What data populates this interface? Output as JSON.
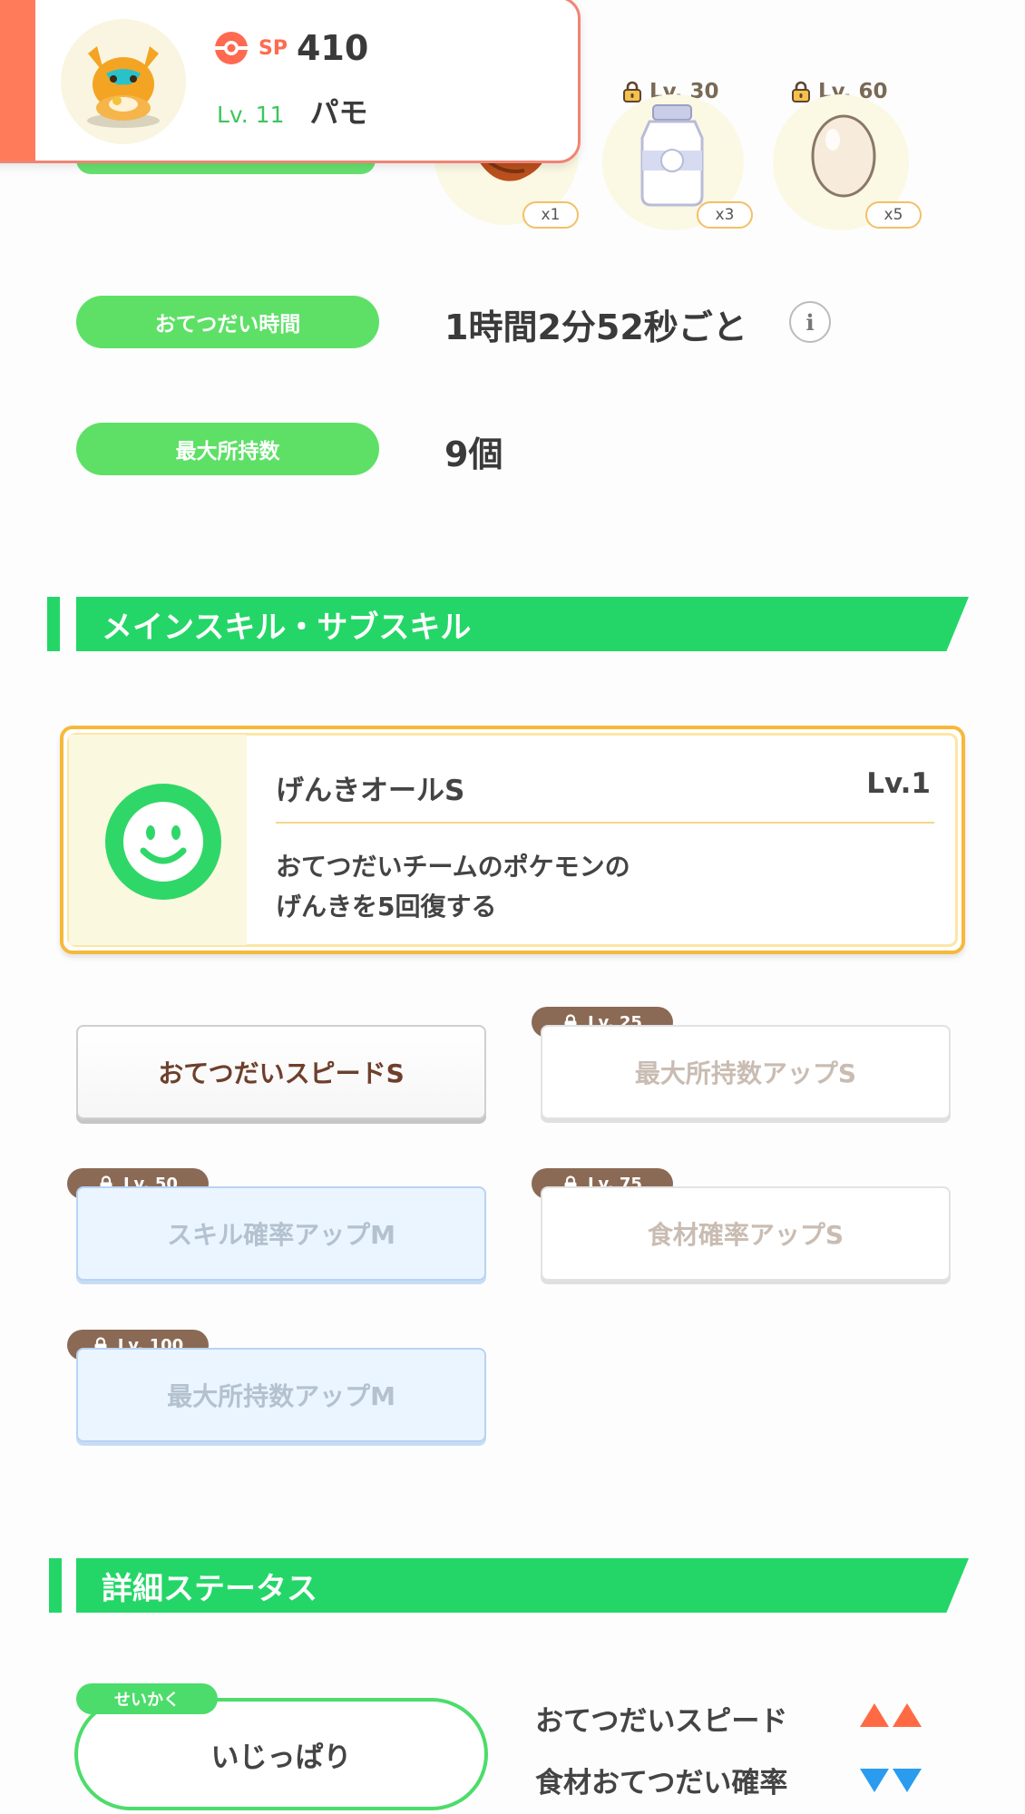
{
  "pokemon": {
    "sp_label": "SP",
    "sp_value": "410",
    "level": "Lv. 11",
    "name": "パモ"
  },
  "ingredients": [
    {
      "count": "x1",
      "unlock_level": "",
      "locked": false,
      "icon": "ingredient-icon"
    },
    {
      "count": "x3",
      "unlock_level": "Lv. 30",
      "locked": true,
      "icon": "milk-bottle-icon"
    },
    {
      "count": "x5",
      "unlock_level": "Lv. 60",
      "locked": true,
      "icon": "egg-icon"
    }
  ],
  "info": {
    "help_time_label": "おてつだい時間",
    "help_time_value": "1時間2分52秒ごと",
    "max_carry_label": "最大所持数",
    "max_carry_value": "9個"
  },
  "sections": {
    "skills_title": "メインスキル・サブスキル",
    "status_title": "詳細ステータス"
  },
  "main_skill": {
    "name": "げんきオールS",
    "level": "Lv.1",
    "desc_line1": "おてつだいチームのポケモンの",
    "desc_line2": "げんきを5回復する",
    "icon": "smile-face-icon"
  },
  "sub_skills": [
    {
      "label": "おてつだいスピードS",
      "lock_level": "",
      "state": "active"
    },
    {
      "label": "最大所持数アップS",
      "lock_level": "Lv. 25",
      "state": "locked"
    },
    {
      "label": "スキル確率アップM",
      "lock_level": "Lv. 50",
      "state": "locked-blue"
    },
    {
      "label": "食材確率アップS",
      "lock_level": "Lv. 75",
      "state": "locked"
    },
    {
      "label": "最大所持数アップM",
      "lock_level": "Lv. 100",
      "state": "locked-blue"
    }
  ],
  "nature": {
    "tag": "せいかく",
    "value": "いじっぱり",
    "up_label": "おてつだいスピード",
    "down_label": "食材おてつだい確率"
  },
  "colors": {
    "green": "#24d667",
    "pill_green": "#5ee067",
    "accent_red": "#ff7b5a",
    "gold": "#f6b93a",
    "up_arrow": "#ff6a45",
    "down_arrow": "#2a9cf0"
  }
}
